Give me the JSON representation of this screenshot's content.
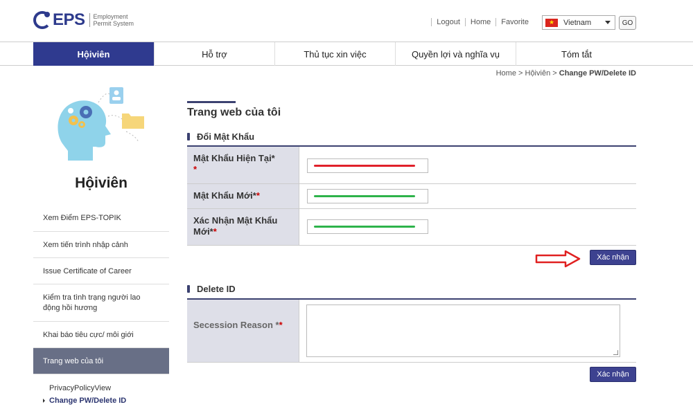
{
  "header": {
    "logo_text": "EPS",
    "logo_sub_line1": "Employment",
    "logo_sub_line2": "Permit System",
    "links": [
      "Logout",
      "Home",
      "Favorite"
    ],
    "language": "Vietnam",
    "go_label": "GO"
  },
  "nav": {
    "items": [
      {
        "label": "Hộiviên",
        "active": true
      },
      {
        "label": "Hỗ trợ"
      },
      {
        "label": "Thủ tục xin việc"
      },
      {
        "label": "Quyền lợi và nghĩa vụ"
      },
      {
        "label": "Tóm tắt"
      }
    ]
  },
  "breadcrumb": {
    "home": "Home",
    "sep": ">",
    "level1": "Hộiviên",
    "current": "Change PW/Delete ID"
  },
  "sidebar": {
    "title": "Hộiviên",
    "items": [
      {
        "label": "Xem Điểm EPS-TOPIK"
      },
      {
        "label": "Xem tiến trình nhập cảnh"
      },
      {
        "label": "Issue Certificate of Career"
      },
      {
        "label": "Kiểm tra tình trạng người lao động hồi hương"
      },
      {
        "label": "Khai báo tiêu cực/ môi giới"
      },
      {
        "label": "Trang web của tôi",
        "active": true
      }
    ],
    "sub_items": [
      {
        "label": "PrivacyPolicyView"
      },
      {
        "label": "Change PW/Delete ID",
        "current": true
      }
    ]
  },
  "main": {
    "title": "Trang web của tôi",
    "change_pw": {
      "section_title": "Đổi Mật Khẩu",
      "current_pw_label": "Mật Khẩu Hiện Tại*",
      "new_pw_label": "Mật Khẩu Mới*",
      "confirm_pw_label": "Xác Nhận Mật Khẩu Mới*",
      "req_mark": "*",
      "submit_label": "Xác nhận"
    },
    "delete_id": {
      "section_title": "Delete ID",
      "reason_label": "Secession Reason *",
      "req_mark": "*",
      "submit_label": "Xác nhận"
    }
  },
  "colors": {
    "brand": "#2f3a8f",
    "redact_red": "#e0202a",
    "redact_green": "#2db34a",
    "annotation_arrow": "#e02020"
  }
}
